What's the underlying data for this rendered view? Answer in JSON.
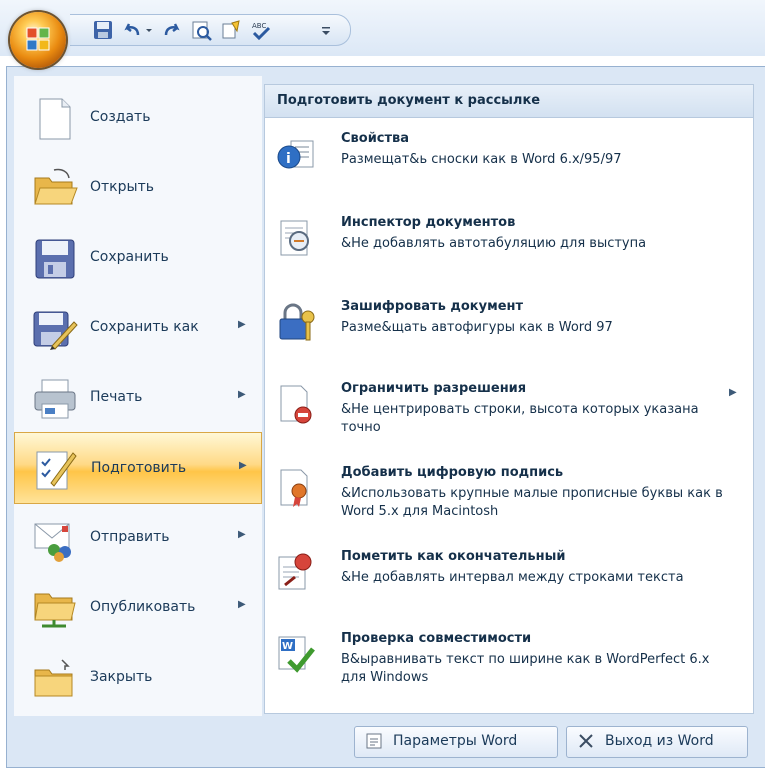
{
  "left_menu": [
    {
      "label": "Создать",
      "icon": "new-document-icon",
      "arrow": ""
    },
    {
      "label": "Открыть",
      "icon": "open-folder-icon",
      "arrow": ""
    },
    {
      "label": "Сохранить",
      "icon": "save-icon",
      "arrow": ""
    },
    {
      "label": "Сохранить как",
      "icon": "save-as-icon",
      "arrow": "▶"
    },
    {
      "label": "Печать",
      "icon": "printer-icon",
      "arrow": "▶"
    },
    {
      "label": "Подготовить",
      "icon": "prepare-icon",
      "arrow": "▶"
    },
    {
      "label": "Отправить",
      "icon": "send-icon",
      "arrow": "▶"
    },
    {
      "label": "Опубликовать",
      "icon": "publish-icon",
      "arrow": "▶"
    },
    {
      "label": "Закрыть",
      "icon": "close-folder-icon",
      "arrow": ""
    }
  ],
  "right_menu": {
    "header": "Подготовить документ к рассылке",
    "items": [
      {
        "title": "Свойства",
        "desc": "Размещат&ь сноски как в Word 6.x/95/97",
        "icon": "properties-icon",
        "arrow": ""
      },
      {
        "title": "Инспектор документов",
        "desc": "&Не добавлять автотабуляцию для выступа",
        "icon": "document-inspector-icon",
        "arrow": ""
      },
      {
        "title": "Зашифровать документ",
        "desc": "Разме&щать автофигуры как в Word 97",
        "icon": "encrypt-lock-icon",
        "arrow": ""
      },
      {
        "title": "Ограничить разрешения",
        "desc": "&Не центрировать строки, высота которых указана точно",
        "icon": "restrict-permission-icon",
        "arrow": "▶"
      },
      {
        "title": "Добавить цифровую подпись",
        "desc": "&Использовать крупные малые прописные буквы как в Word 5.x для Macintosh",
        "icon": "digital-signature-icon",
        "arrow": ""
      },
      {
        "title": "Пометить как окончательный",
        "desc": "&Не добавлять интервал между строками текста",
        "icon": "mark-final-icon",
        "arrow": ""
      },
      {
        "title": "Проверка совместимости",
        "desc": "В&ыравнивать текст по ширине как в WordPerfect 6.x для Windows",
        "icon": "compatibility-check-icon",
        "arrow": ""
      }
    ]
  },
  "footer": {
    "options_label": "Параметры Word",
    "exit_label": "Выход из Word"
  },
  "quick_access": [
    "save-icon",
    "undo-icon",
    "undo-dropdown-icon",
    "redo-icon",
    "preview-icon",
    "format-icon",
    "spelling-icon",
    "customize-icon"
  ]
}
